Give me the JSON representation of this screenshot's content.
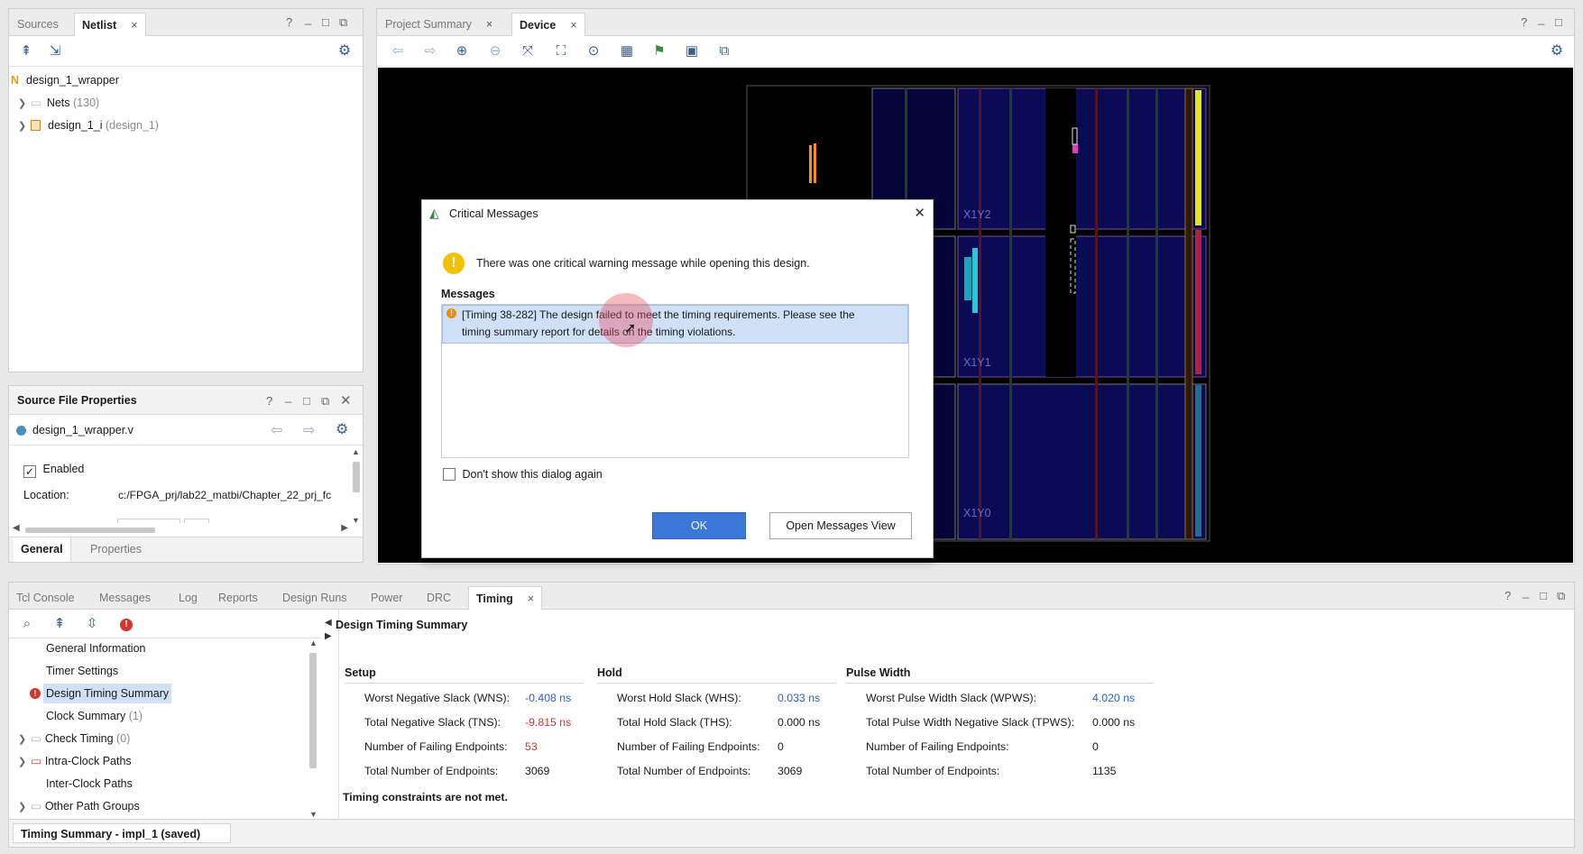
{
  "netlist_panel": {
    "tabs": [
      "Sources",
      "Netlist"
    ],
    "close_glyph": "×",
    "help": "?",
    "minimize": "_",
    "maximize": "□",
    "restore": "⧉",
    "top_icon": "N",
    "tree": [
      {
        "label": "design_1_wrapper",
        "suffix": ""
      },
      {
        "label": "Nets",
        "suffix": "(130)"
      },
      {
        "label": "design_1_i",
        "suffix": "(design_1)"
      }
    ]
  },
  "source_props": {
    "title": "Source File Properties",
    "file": "design_1_wrapper.v",
    "enabled_label": "Enabled",
    "location_label": "Location:",
    "location_value": "c:/FPGA_prj/lab22_matbi/Chapter_22_prj_fc",
    "tabs": [
      "General",
      "Properties"
    ]
  },
  "device_panel": {
    "tabs": [
      "Project Summary",
      "Device"
    ],
    "clock_regions": [
      "X1Y2",
      "X1Y1",
      "X1Y0"
    ]
  },
  "dialog": {
    "title": "Critical Messages",
    "close_glyph": "✕",
    "intro": "There was one critical warning message while opening this design.",
    "messages_label": "Messages",
    "message_line1": "[Timing 38-282] The design failed to meet the timing requirements. Please see the",
    "message_line2": "timing summary report for details on the timing violations.",
    "dont_show": "Don't show this dialog again",
    "ok": "OK",
    "open_view": "Open Messages View"
  },
  "bottom_panel": {
    "tabs": [
      "Tcl Console",
      "Messages",
      "Log",
      "Reports",
      "Design Runs",
      "Power",
      "DRC",
      "Timing"
    ],
    "summary_title": "Design Timing Summary",
    "nav": [
      {
        "label": "General Information",
        "suffix": ""
      },
      {
        "label": "Timer Settings",
        "suffix": ""
      },
      {
        "label": "Design Timing Summary",
        "suffix": ""
      },
      {
        "label": "Clock Summary",
        "suffix": "(1)"
      },
      {
        "label": "Check Timing",
        "suffix": "(0)"
      },
      {
        "label": "Intra-Clock Paths",
        "suffix": ""
      },
      {
        "label": "Inter-Clock Paths",
        "suffix": ""
      },
      {
        "label": "Other Path Groups",
        "suffix": ""
      }
    ],
    "status": "Timing Summary - impl_1 (saved)",
    "setup": {
      "header": "Setup",
      "rows": [
        {
          "label": "Worst Negative Slack (WNS):",
          "value": "-0.408 ns"
        },
        {
          "label": "Total Negative Slack (TNS):",
          "value": "-9.815 ns"
        },
        {
          "label": "Number of Failing Endpoints:",
          "value": "53"
        },
        {
          "label": "Total Number of Endpoints:",
          "value": "3069"
        }
      ]
    },
    "hold": {
      "header": "Hold",
      "rows": [
        {
          "label": "Worst Hold Slack (WHS):",
          "value": "0.033 ns"
        },
        {
          "label": "Total Hold Slack (THS):",
          "value": "0.000 ns"
        },
        {
          "label": "Number of Failing Endpoints:",
          "value": "0"
        },
        {
          "label": "Total Number of Endpoints:",
          "value": "3069"
        }
      ]
    },
    "pulse": {
      "header": "Pulse Width",
      "rows": [
        {
          "label": "Worst Pulse Width Slack (WPWS):",
          "value": "4.020 ns"
        },
        {
          "label": "Total Pulse Width Negative Slack (TPWS):",
          "value": "0.000 ns"
        },
        {
          "label": "Number of Failing Endpoints:",
          "value": "0"
        },
        {
          "label": "Total Number of Endpoints:",
          "value": "1135"
        }
      ]
    },
    "footer": "Timing constraints are not met."
  },
  "colors": {
    "accent": "#3b78d8",
    "fail": "#d6352b",
    "link": "#2a62c9",
    "warn": "#f2c200"
  }
}
